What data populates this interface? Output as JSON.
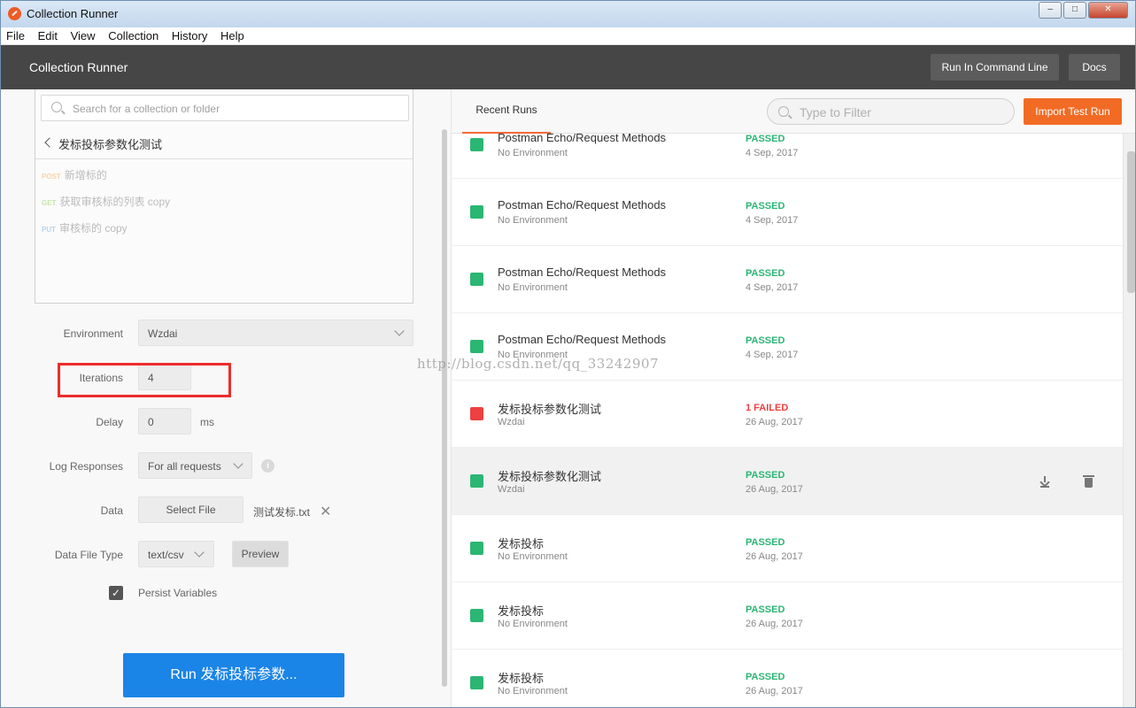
{
  "window": {
    "title": "Collection Runner",
    "controls": [
      "–",
      "□",
      "✕"
    ]
  },
  "menu": [
    "File",
    "Edit",
    "View",
    "Collection",
    "History",
    "Help"
  ],
  "appbar": {
    "title": "Collection Runner",
    "run_cmd_label": "Run In Command Line",
    "docs_label": "Docs"
  },
  "collection": {
    "search_placeholder": "Search for a collection or folder",
    "name": "发标投标参数化测试",
    "requests": [
      {
        "method": "POST",
        "name": "新增标的"
      },
      {
        "method": "GET",
        "name": "获取审核标的列表 copy"
      },
      {
        "method": "PUT",
        "name": "审核标的 copy"
      }
    ]
  },
  "settings": {
    "environment_label": "Environment",
    "environment_value": "Wzdai",
    "iterations_label": "Iterations",
    "iterations_value": "4",
    "delay_label": "Delay",
    "delay_value": "0",
    "delay_unit": "ms",
    "log_label": "Log Responses",
    "log_value": "For all requests",
    "data_label": "Data",
    "select_file_label": "Select File",
    "file_name": "测试发标.txt",
    "data_file_type_label": "Data File Type",
    "data_file_type_value": "text/csv",
    "preview_label": "Preview",
    "persist_label": "Persist Variables",
    "persist_checked": true,
    "run_label": "Run 发标投标参数..."
  },
  "recent": {
    "tab_label": "Recent Runs",
    "filter_placeholder": "Type to Filter",
    "import_label": "Import Test Run",
    "runs": [
      {
        "name": "Postman Echo/Request Methods",
        "env": "No Environment",
        "status": "PASSED",
        "date": "4 Sep, 2017"
      },
      {
        "name": "Postman Echo/Request Methods",
        "env": "No Environment",
        "status": "PASSED",
        "date": "4 Sep, 2017"
      },
      {
        "name": "Postman Echo/Request Methods",
        "env": "No Environment",
        "status": "PASSED",
        "date": "4 Sep, 2017"
      },
      {
        "name": "Postman Echo/Request Methods",
        "env": "No Environment",
        "status": "PASSED",
        "date": "4 Sep, 2017"
      },
      {
        "name": "发标投标参数化测试",
        "env": "Wzdai",
        "status": "1 FAILED",
        "date": "26 Aug, 2017"
      },
      {
        "name": "发标投标参数化测试",
        "env": "Wzdai",
        "status": "PASSED",
        "date": "26 Aug, 2017"
      },
      {
        "name": "发标投标",
        "env": "No Environment",
        "status": "PASSED",
        "date": "26 Aug, 2017"
      },
      {
        "name": "发标投标",
        "env": "No Environment",
        "status": "PASSED",
        "date": "26 Aug, 2017"
      },
      {
        "name": "发标投标",
        "env": "No Environment",
        "status": "PASSED",
        "date": "26 Aug, 2017"
      }
    ]
  },
  "watermark": "http://blog.csdn.net/qq_33242907",
  "colors": {
    "passed": "#2bb673",
    "failed": "#ee4040",
    "accent": "#f26b25",
    "run_button": "#1b84e7"
  }
}
